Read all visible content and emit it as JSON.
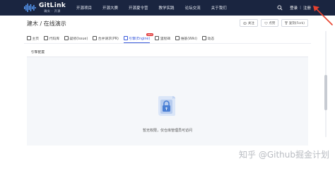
{
  "colors": {
    "topbar": "#1a2540",
    "accent": "#3b5bdb",
    "arrow": "#e8412d"
  },
  "brand": {
    "name": "GitLink",
    "tagline": "确实 · 开源"
  },
  "topnav": {
    "items": [
      "开源项目",
      "开源大赛",
      "开源夏令营",
      "教学实践",
      "论坛交流",
      "关于我们"
    ],
    "login": "登录",
    "register": "注册"
  },
  "repo": {
    "title": "建木 / 在线演示",
    "actions": [
      {
        "label": "关注",
        "count": "",
        "icon": "eye-icon"
      },
      {
        "label": "点赞",
        "count": "",
        "icon": "heart-icon"
      },
      {
        "label": "复刻(Fork)",
        "count": "",
        "icon": "fork-icon"
      }
    ]
  },
  "tabs": [
    {
      "label": "主页",
      "icon": "home-icon"
    },
    {
      "label": "代码库",
      "icon": "code-icon"
    },
    {
      "label": "疑修(Issue)",
      "icon": "issue-icon"
    },
    {
      "label": "合并请求(PR)",
      "icon": "pr-icon"
    },
    {
      "label": "引擎(Engine)",
      "icon": "engine-icon",
      "active": true,
      "badge": "NEW"
    },
    {
      "label": "里程碑",
      "icon": "milestone-icon"
    },
    {
      "label": "维基(Wiki)",
      "icon": "wiki-icon"
    },
    {
      "label": "动态",
      "icon": "activity-icon"
    }
  ],
  "panel": {
    "title": "引擎配置",
    "empty_icon": "lock-document-icon",
    "empty_message": "暂无权限，仅仓库管理员可访问"
  },
  "watermark": "知乎 @Github掘金计划"
}
